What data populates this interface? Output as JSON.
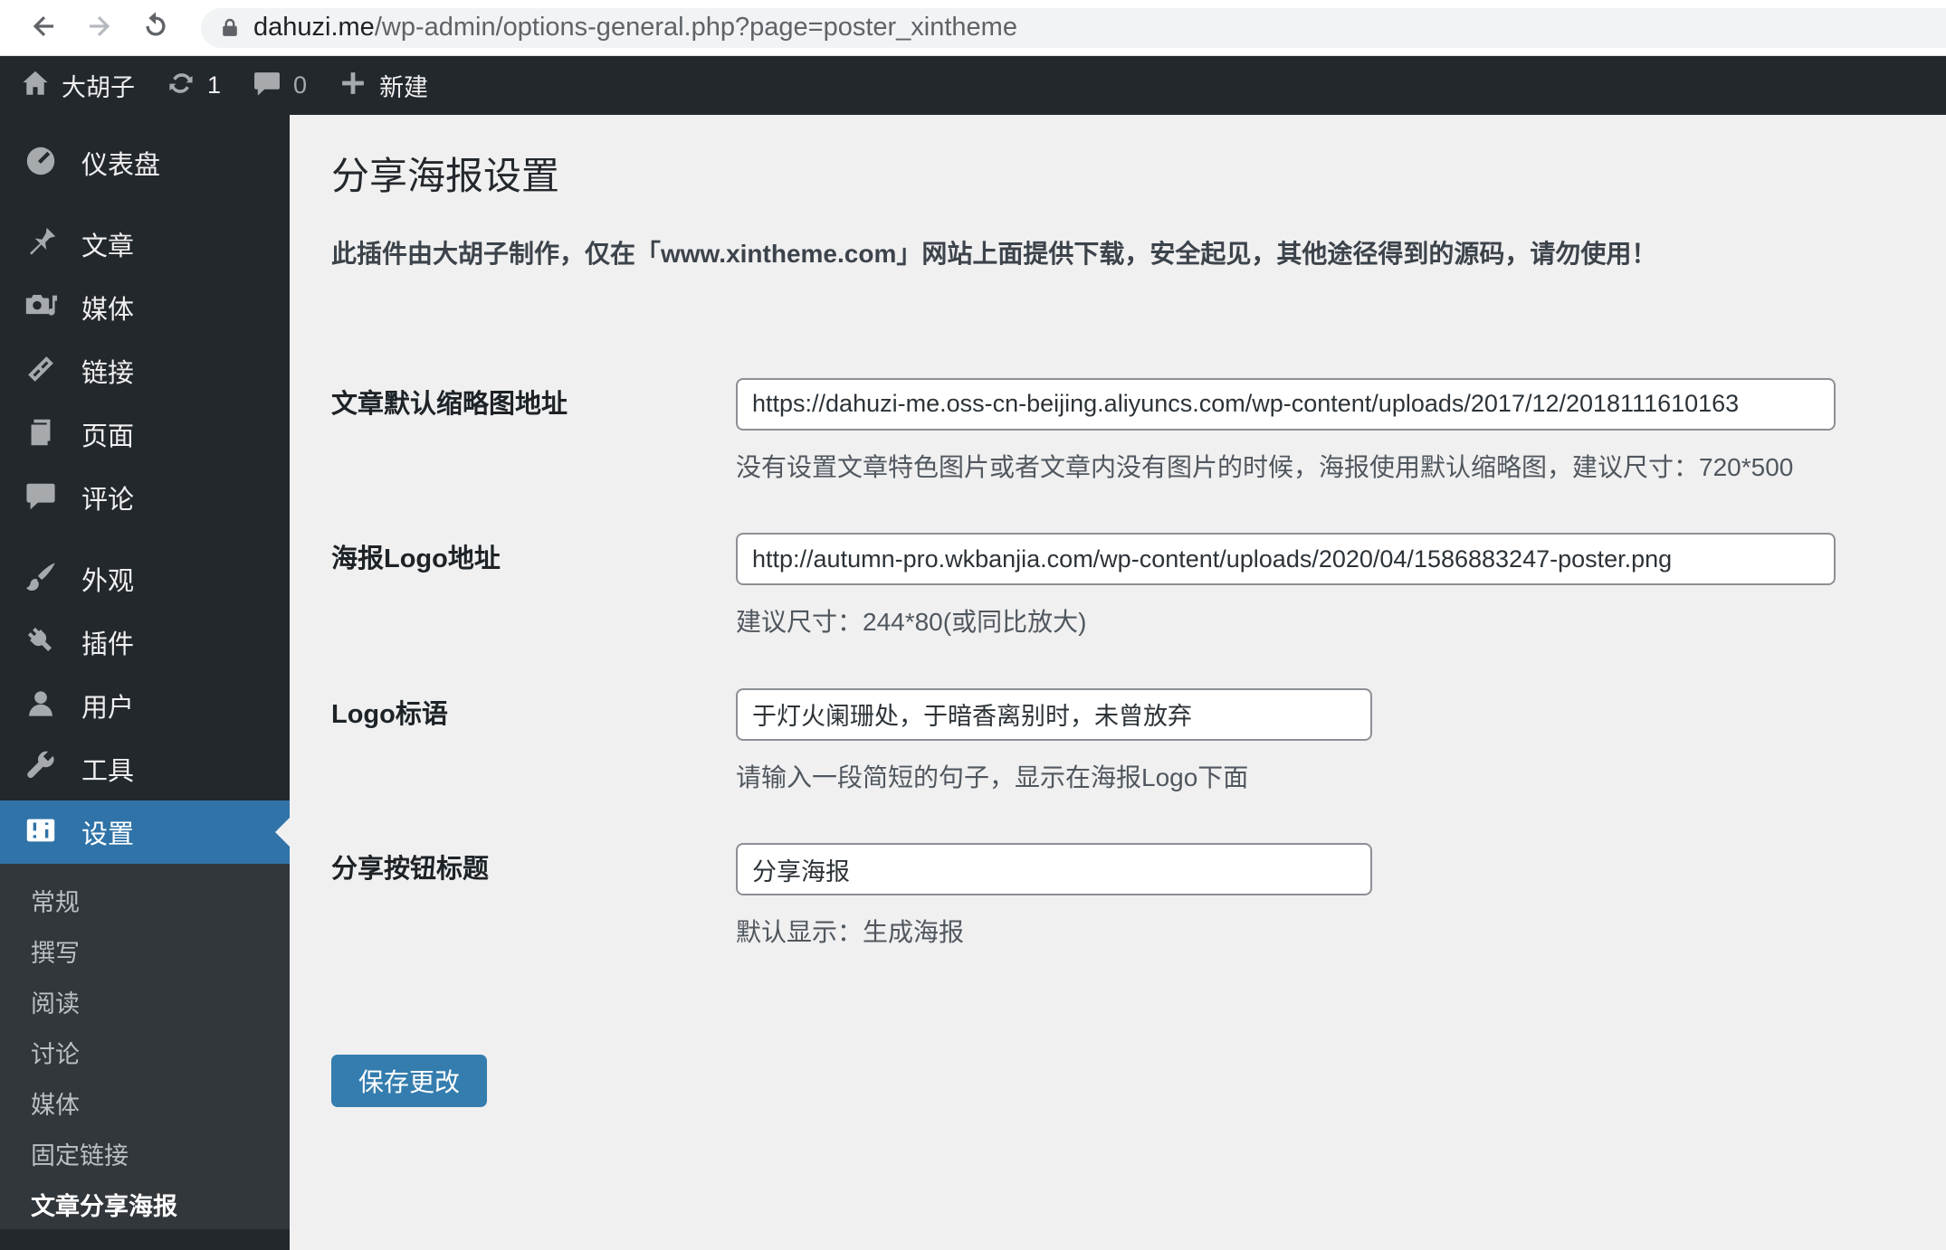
{
  "browser": {
    "url_host": "dahuzi.me",
    "url_path": "/wp-admin/options-general.php?page=poster_xintheme"
  },
  "admin_bar": {
    "site_name": "大胡子",
    "update_count": "1",
    "comment_count": "0",
    "new_label": "新建"
  },
  "sidebar": {
    "items": [
      {
        "label": "仪表盘"
      },
      {
        "label": "文章"
      },
      {
        "label": "媒体"
      },
      {
        "label": "链接"
      },
      {
        "label": "页面"
      },
      {
        "label": "评论"
      },
      {
        "label": "外观"
      },
      {
        "label": "插件"
      },
      {
        "label": "用户"
      },
      {
        "label": "工具"
      },
      {
        "label": "设置"
      }
    ],
    "submenu": [
      {
        "label": "常规"
      },
      {
        "label": "撰写"
      },
      {
        "label": "阅读"
      },
      {
        "label": "讨论"
      },
      {
        "label": "媒体"
      },
      {
        "label": "固定链接"
      },
      {
        "label": "文章分享海报"
      }
    ]
  },
  "main": {
    "title": "分享海报设置",
    "notice": "此插件由大胡子制作，仅在「www.xintheme.com」网站上面提供下载，安全起见，其他途径得到的源码，请勿使用！",
    "form": {
      "rows": [
        {
          "label": "文章默认缩略图地址",
          "value": "https://dahuzi-me.oss-cn-beijing.aliyuncs.com/wp-content/uploads/2017/12/2018111610163",
          "helper": "没有设置文章特色图片或者文章内没有图片的时候，海报使用默认缩略图，建议尺寸：720*500"
        },
        {
          "label": "海报Logo地址",
          "value": "http://autumn-pro.wkbanjia.com/wp-content/uploads/2020/04/1586883247-poster.png",
          "helper": "建议尺寸：244*80(或同比放大)"
        },
        {
          "label": "Logo标语",
          "value": "于灯火阑珊处，于暗香离别时，未曾放弃",
          "helper": "请输入一段简短的句子，显示在海报Logo下面"
        },
        {
          "label": "分享按钮标题",
          "value": "分享海报",
          "helper": "默认显示：生成海报"
        }
      ],
      "save_label": "保存更改"
    }
  },
  "colors": {
    "admin_bar_bg": "#23282d",
    "sidebar_bg": "#23282d",
    "submenu_bg": "#32373c",
    "active_menu_bg": "#2f73a8",
    "button_bg": "#347dae",
    "content_bg": "#f0f0f1",
    "address_pill_bg": "#f1f3f4"
  }
}
